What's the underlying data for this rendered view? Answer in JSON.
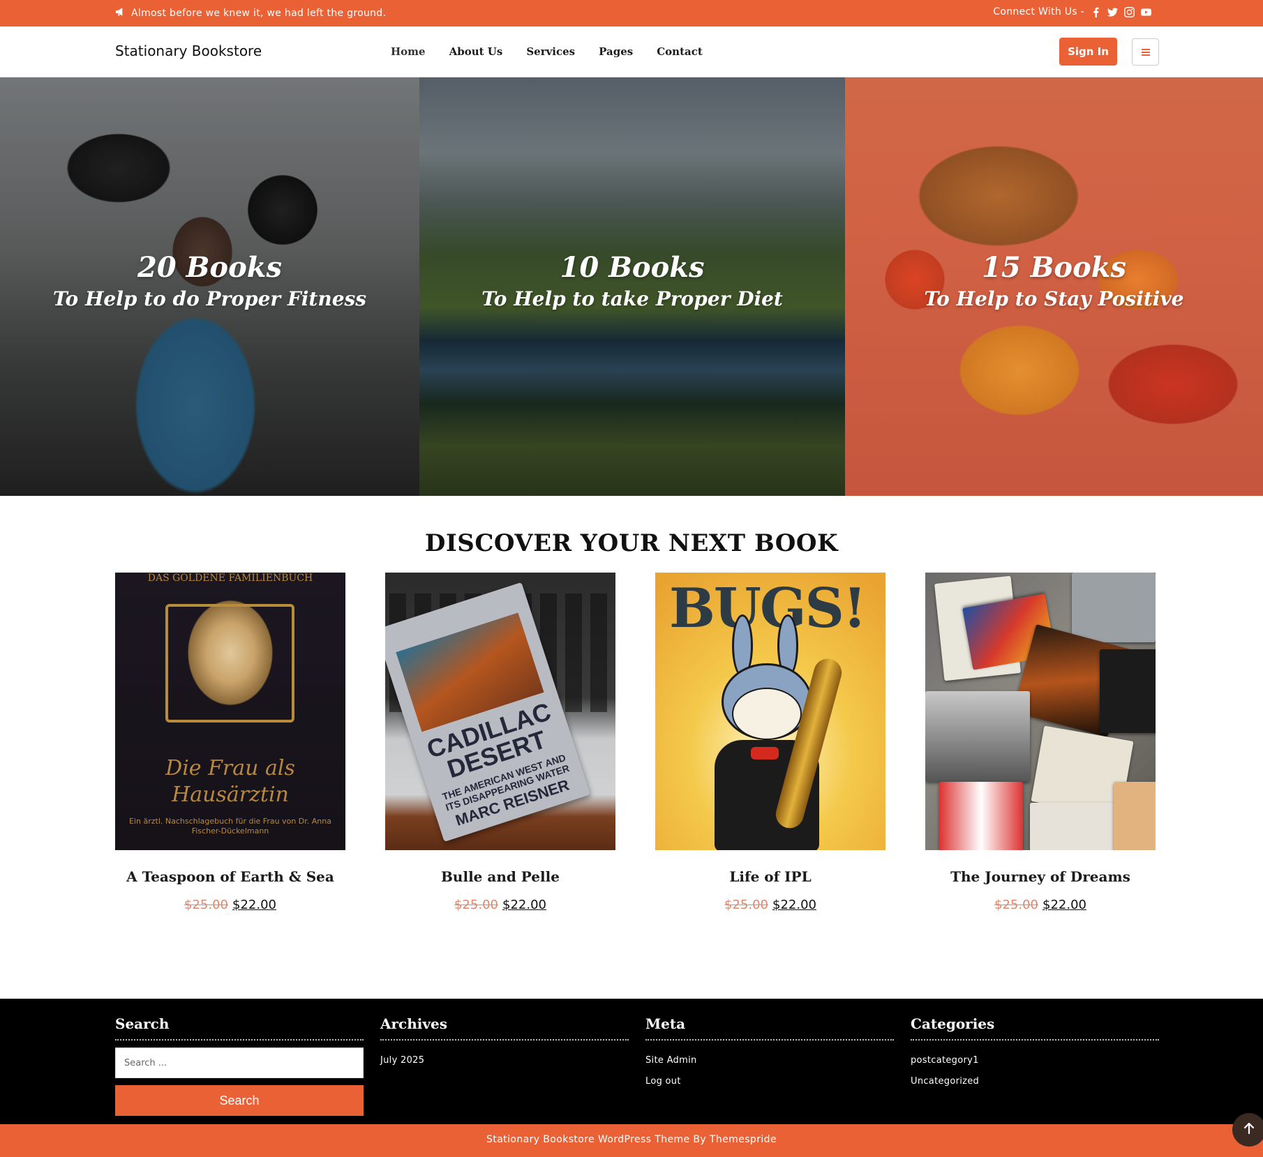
{
  "topbar": {
    "message": "Almost before we knew it, we had left the ground.",
    "connect_label": "Connect With Us -",
    "social": [
      "facebook-icon",
      "twitter-icon",
      "instagram-icon",
      "youtube-icon"
    ]
  },
  "header": {
    "brand": "Stationary Bookstore",
    "nav": [
      "Home",
      "About Us",
      "Services",
      "Pages",
      "Contact"
    ],
    "signin_label": "Sign In"
  },
  "hero": [
    {
      "title": "20 Books",
      "subtitle": "To Help to do Proper Fitness"
    },
    {
      "title": "10 Books",
      "subtitle": "To Help to take Proper Diet"
    },
    {
      "title": "15 Books",
      "subtitle": "To Help to Stay Positive"
    }
  ],
  "discover": {
    "heading": "DISCOVER YOUR NEXT BOOK",
    "products": [
      {
        "name": "A Teaspoon of Earth & Sea",
        "old_price": "$25.00",
        "price": "$22.00"
      },
      {
        "name": "Bulle and Pelle",
        "old_price": "$25.00",
        "price": "$22.00"
      },
      {
        "name": "Life of IPL",
        "old_price": "$25.00",
        "price": "$22.00"
      },
      {
        "name": "The Journey of Dreams",
        "old_price": "$25.00",
        "price": "$22.00"
      }
    ],
    "covers": {
      "book1": {
        "top": "DAS GOLDENE FAMILIENBUCH",
        "title": "Die Frau als Hausärztin",
        "foot": "Ein ärztl. Nachschlagebuch für die Frau von Dr. Anna Fischer-Dückelmann"
      },
      "book2": {
        "title": "CADILLAC DESERT",
        "subtitle": "THE AMERICAN WEST AND ITS DISAPPEARING WATER",
        "author": "MARC REISNER"
      },
      "book3": {
        "title": "BUGS!"
      }
    }
  },
  "footer": {
    "search": {
      "heading": "Search",
      "placeholder": "Search ...",
      "button": "Search"
    },
    "archives": {
      "heading": "Archives",
      "items": [
        "July 2025"
      ]
    },
    "meta": {
      "heading": "Meta",
      "items": [
        "Site Admin",
        "Log out"
      ]
    },
    "categories": {
      "heading": "Categories",
      "items": [
        "postcategory1",
        "Uncategorized"
      ]
    },
    "credit": "Stationary Bookstore WordPress Theme By Themespride"
  },
  "colors": {
    "accent": "#ea6135",
    "footer_bg": "#000000"
  }
}
